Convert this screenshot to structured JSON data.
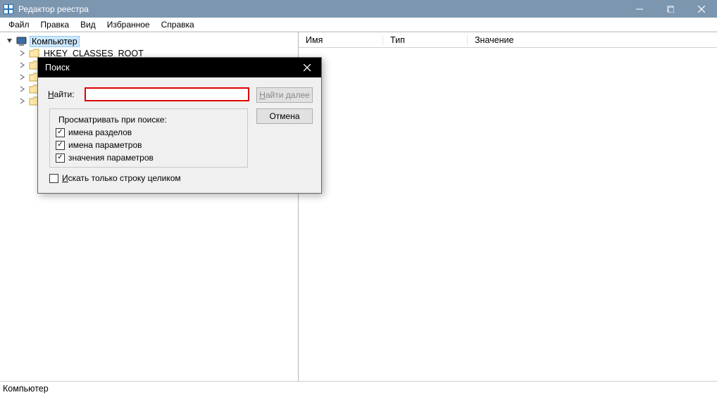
{
  "titlebar": {
    "title": "Редактор реестра"
  },
  "menu": {
    "file": "Файл",
    "edit": "Правка",
    "view": "Вид",
    "favorites": "Избранное",
    "help": "Справка"
  },
  "tree": {
    "root": "Компьютер",
    "items": [
      "HKEY_CLASSES_ROOT"
    ]
  },
  "listview": {
    "col1": "Имя",
    "col2": "Тип",
    "col3": "Значение"
  },
  "statusbar": "Компьютер",
  "dialog": {
    "title": "Поиск",
    "find_label_pre": "Н",
    "find_label_post": "айти:",
    "group_title": "Просматривать при поиске:",
    "cb_keys": "имена разделов",
    "cb_values": "имена параметров",
    "cb_data": "значения параметров",
    "cb_whole": "Искать только строку целиком",
    "cb_whole_u": "И",
    "btn_find_next_u": "Н",
    "btn_find_next": "айти далее",
    "btn_cancel": "Отмена",
    "input_value": ""
  }
}
